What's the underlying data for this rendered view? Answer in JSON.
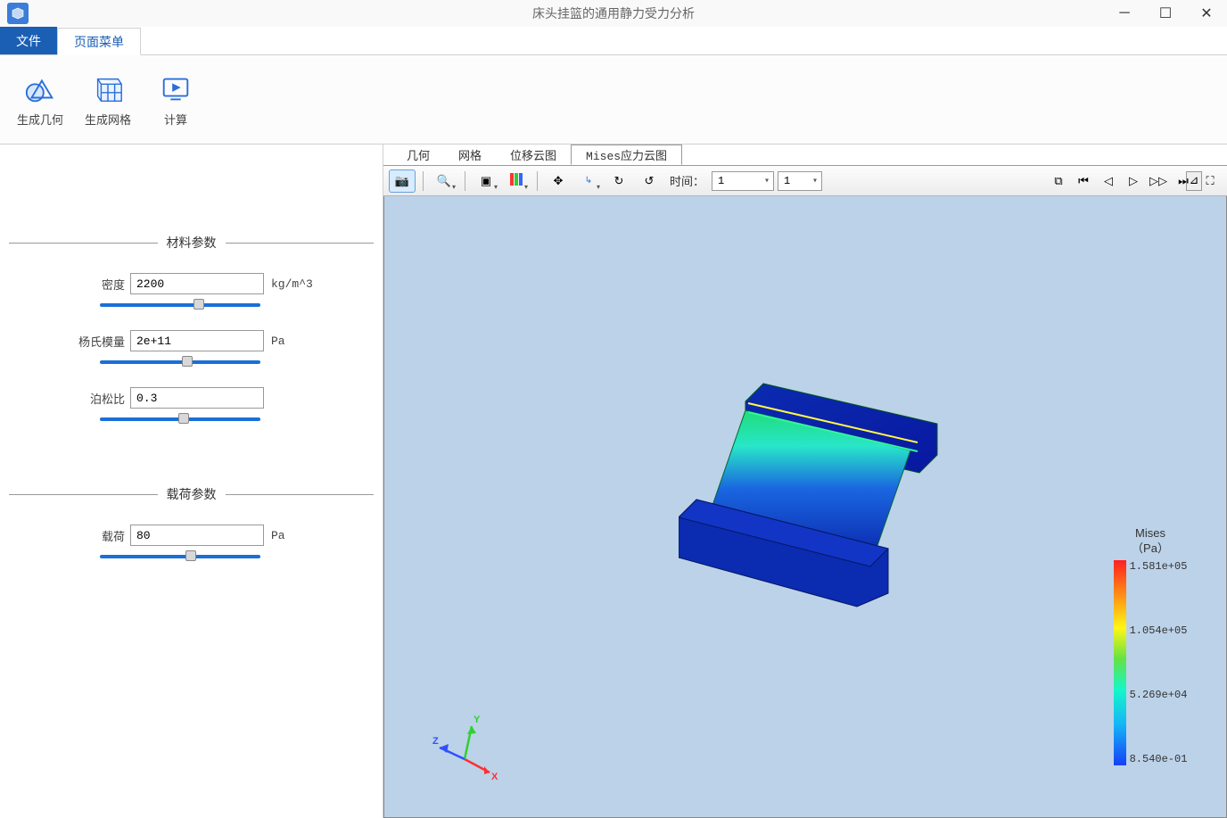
{
  "window": {
    "title": "床头挂篮的通用静力受力分析"
  },
  "ribbon": {
    "tabs": {
      "file": "文件",
      "page_menu": "页面菜单"
    },
    "buttons": {
      "gen_geometry": "生成几何",
      "gen_mesh": "生成网格",
      "compute": "计算"
    }
  },
  "sidebar": {
    "section_material": "材料参数",
    "section_load": "载荷参数",
    "params": {
      "density": {
        "label": "密度",
        "value": "2200",
        "unit": "kg/m^3"
      },
      "youngs": {
        "label": "杨氏模量",
        "value": "2e+11",
        "unit": "Pa"
      },
      "poisson": {
        "label": "泊松比",
        "value": "0.3",
        "unit": ""
      },
      "load": {
        "label": "载荷",
        "value": "80",
        "unit": "Pa"
      }
    }
  },
  "view_tabs": {
    "geometry": "几何",
    "mesh": "网格",
    "displacement": "位移云图",
    "mises": "Mises应力云图"
  },
  "toolbar": {
    "time_label": "时间：",
    "time_value": "1",
    "frame_value": "1",
    "end_btn": "⊿"
  },
  "legend": {
    "title1": "Mises",
    "title2": "（Pa）",
    "ticks": [
      "1.581e+05",
      "1.054e+05",
      "5.269e+04",
      "8.540e-01"
    ]
  },
  "triad": {
    "x": "X",
    "y": "Y",
    "z": "Z"
  }
}
